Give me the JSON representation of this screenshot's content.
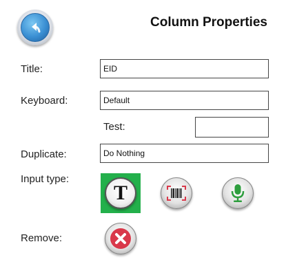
{
  "header": {
    "title": "Column Properties",
    "back_icon": "back-arrow-icon"
  },
  "form": {
    "title_label": "Title:",
    "title_value": "EID",
    "keyboard_label": "Keyboard:",
    "keyboard_value": "Default",
    "test_label": "Test:",
    "test_value": "",
    "duplicate_label": "Duplicate:",
    "duplicate_value": "Do Nothing",
    "input_type_label": "Input type:",
    "remove_label": "Remove:"
  },
  "input_types": [
    {
      "icon": "text-t-icon",
      "selected": true
    },
    {
      "icon": "barcode-scan-icon",
      "selected": false
    },
    {
      "icon": "microphone-icon",
      "selected": false
    }
  ],
  "colors": {
    "selected_highlight": "#23b04b",
    "remove_red": "#d9384a",
    "mic_green": "#2e9e3e",
    "back_blue": "#3a8fd3"
  }
}
